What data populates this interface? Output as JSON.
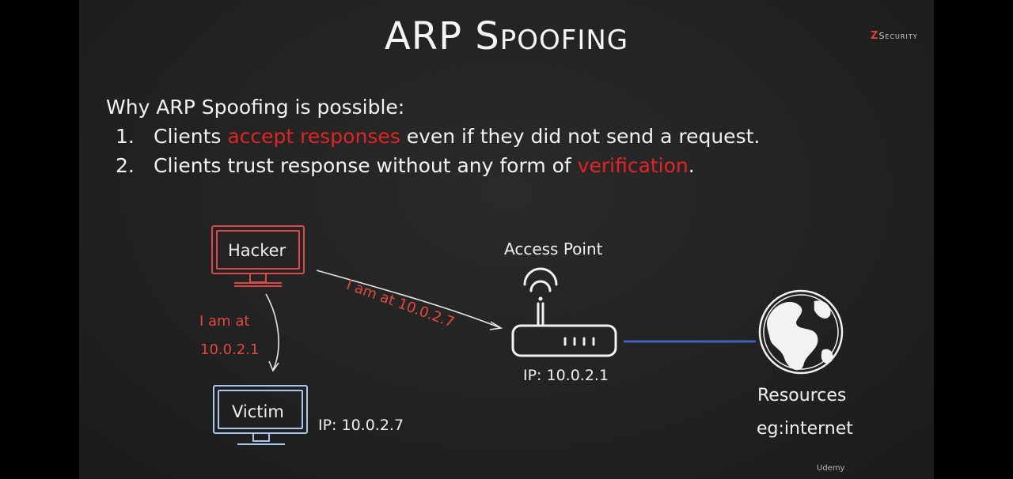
{
  "title": "ARP Spoofing",
  "brand": {
    "z": "Z",
    "rest": "Security"
  },
  "intro": "Why ARP Spoofing is possible:",
  "points": [
    {
      "num": "1.",
      "pre": "Clients ",
      "highlight": "accept responses",
      "post": " even if they did not send a request."
    },
    {
      "num": "2.",
      "pre": "Clients trust response without any form of ",
      "highlight": "verification",
      "post": "."
    }
  ],
  "diagram": {
    "hacker_label": "Hacker",
    "victim_label": "Victim",
    "victim_ip": "IP: 10.0.2.7",
    "ap_title": "Access Point",
    "ap_ip": "IP: 10.0.2.1",
    "resources_line1": "Resources",
    "resources_line2": "eg:internet",
    "msg_to_ap": "I am at 10.0.2.7",
    "msg_to_victim_line1": "I am at",
    "msg_to_victim_line2": "10.0.2.1"
  },
  "colors": {
    "red": "#e32424",
    "hacker": "#d94a4a",
    "victim": "#a9c6ef",
    "link": "#3c63b8"
  },
  "watermark": "Udemy"
}
